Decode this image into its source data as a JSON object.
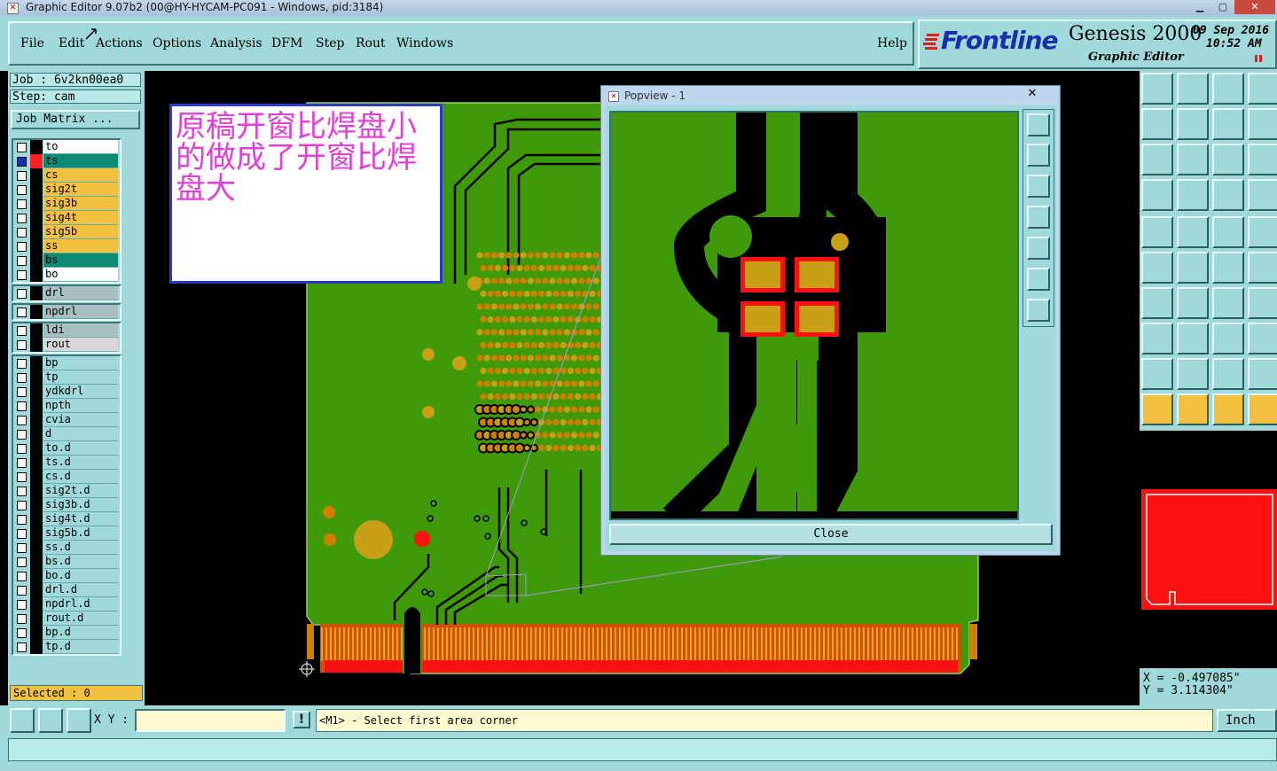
{
  "window": {
    "title": "Graphic Editor 9.07b2 (00@HY-HYCAM-PC091 - Windows, pid:3184)",
    "app_icon": "x-icon",
    "controls": [
      "minimize-icon",
      "maximize-icon",
      "close-icon"
    ]
  },
  "menu": {
    "items": [
      "File",
      "Edit",
      "Actions",
      "Options",
      "Analysis",
      "DFM",
      "Step",
      "Rout",
      "Windows"
    ],
    "help": "Help"
  },
  "branding": {
    "logo": "Frontline",
    "product": "Genesis 2000",
    "subtitle": "Graphic Editor",
    "date": "09 Sep 2016",
    "time": "10:52 AM"
  },
  "job": {
    "job_line": "Job : 6v2kn00ea0",
    "step_line": "Step: cam",
    "matrix_button": "Job Matrix ..."
  },
  "layers": {
    "board": [
      {
        "name": "to",
        "color": "#ffffff",
        "swatch": "#000000",
        "checked": false
      },
      {
        "name": "ts",
        "color": "#0d8a74",
        "swatch": "#ff2020",
        "checked": true
      },
      {
        "name": "cs",
        "color": "#f4c040",
        "swatch": "#000000",
        "checked": false
      },
      {
        "name": "sig2t",
        "color": "#f4c040",
        "swatch": "#000000",
        "checked": false
      },
      {
        "name": "sig3b",
        "color": "#f4c040",
        "swatch": "#000000",
        "checked": false
      },
      {
        "name": "sig4t",
        "color": "#f4c040",
        "swatch": "#000000",
        "checked": false
      },
      {
        "name": "sig5b",
        "color": "#f4c040",
        "swatch": "#000000",
        "checked": false
      },
      {
        "name": "ss",
        "color": "#f4c040",
        "swatch": "#000000",
        "checked": false
      },
      {
        "name": "bs",
        "color": "#0d8a74",
        "swatch": "#000000",
        "checked": false
      },
      {
        "name": "bo",
        "color": "#ffffff",
        "swatch": "#000000",
        "checked": false
      }
    ],
    "drill": [
      {
        "name": "drl",
        "color": "#a8c0c0",
        "swatch": "#000000",
        "checked": false
      }
    ],
    "npdrill": [
      {
        "name": "npdrl",
        "color": "#a8c0c0",
        "swatch": "#000000",
        "checked": false
      }
    ],
    "rout": [
      {
        "name": "ldi",
        "color": "#a8c0c0",
        "swatch": "#000000",
        "checked": false
      },
      {
        "name": "rout",
        "color": "#d8d8d8",
        "swatch": "#000000",
        "checked": false
      }
    ],
    "misc": [
      {
        "name": "bp",
        "color": "#9fd9d9",
        "swatch": "#000000",
        "checked": false
      },
      {
        "name": "tp",
        "color": "#9fd9d9",
        "swatch": "#000000",
        "checked": false
      },
      {
        "name": "ydkdrl",
        "color": "#9fd9d9",
        "swatch": "#000000",
        "checked": false
      },
      {
        "name": "npth",
        "color": "#9fd9d9",
        "swatch": "#000000",
        "checked": false
      },
      {
        "name": "cvia",
        "color": "#9fd9d9",
        "swatch": "#000000",
        "checked": false
      },
      {
        "name": "d",
        "color": "#9fd9d9",
        "swatch": "#000000",
        "checked": false
      },
      {
        "name": "to.d",
        "color": "#9fd9d9",
        "swatch": "#000000",
        "checked": false
      },
      {
        "name": "ts.d",
        "color": "#9fd9d9",
        "swatch": "#000000",
        "checked": false
      },
      {
        "name": "cs.d",
        "color": "#9fd9d9",
        "swatch": "#000000",
        "checked": false
      },
      {
        "name": "sig2t.d",
        "color": "#9fd9d9",
        "swatch": "#000000",
        "checked": false
      },
      {
        "name": "sig3b.d",
        "color": "#9fd9d9",
        "swatch": "#000000",
        "checked": false
      },
      {
        "name": "sig4t.d",
        "color": "#9fd9d9",
        "swatch": "#000000",
        "checked": false
      },
      {
        "name": "sig5b.d",
        "color": "#9fd9d9",
        "swatch": "#000000",
        "checked": false
      },
      {
        "name": "ss.d",
        "color": "#9fd9d9",
        "swatch": "#000000",
        "checked": false
      },
      {
        "name": "bs.d",
        "color": "#9fd9d9",
        "swatch": "#000000",
        "checked": false
      },
      {
        "name": "bo.d",
        "color": "#9fd9d9",
        "swatch": "#000000",
        "checked": false
      },
      {
        "name": "drl.d",
        "color": "#9fd9d9",
        "swatch": "#000000",
        "checked": false
      },
      {
        "name": "npdrl.d",
        "color": "#9fd9d9",
        "swatch": "#000000",
        "checked": false
      },
      {
        "name": "rout.d",
        "color": "#9fd9d9",
        "swatch": "#000000",
        "checked": false
      },
      {
        "name": "bp.d",
        "color": "#9fd9d9",
        "swatch": "#000000",
        "checked": false
      },
      {
        "name": "tp.d",
        "color": "#9fd9d9",
        "swatch": "#000000",
        "checked": false
      }
    ],
    "selected": "Selected : 0"
  },
  "annotation": {
    "text": "原稿开窗比焊盘小的做成了开窗比焊盘大"
  },
  "popview": {
    "title": "Popview - 1",
    "close_label": "Close",
    "close_icon": "✕"
  },
  "colors": {
    "board": "#3e9a08",
    "copper": "#c8a018",
    "pad": "#e0a010",
    "mask": "#ff1010",
    "panel": "#9fd9d9",
    "highlight": "#f4c040"
  },
  "coords": {
    "x": "X = -0.497085\"",
    "y": "Y = 3.114304\""
  },
  "bottom": {
    "xy_label": "X Y :",
    "xy_value": "",
    "exclaim": "!",
    "prompt": "<M1> - Select first area corner",
    "units": "Inch"
  }
}
